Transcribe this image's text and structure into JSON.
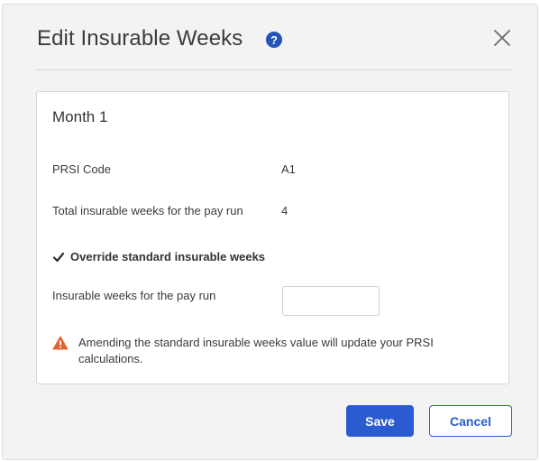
{
  "dialog": {
    "title": "Edit Insurable Weeks",
    "help_icon": "question-circle-icon",
    "close_icon": "close-x-icon"
  },
  "card": {
    "title": "Month 1",
    "prsi_code_label": "PRSI Code",
    "prsi_code_value": "A1",
    "total_weeks_label": "Total insurable weeks for the pay run",
    "total_weeks_value": "4",
    "override_checkbox_label": "Override standard insurable weeks",
    "override_checked": true,
    "weeks_input_label": "Insurable weeks for the pay run",
    "weeks_input_value": "",
    "warning_icon": "warning-triangle-icon",
    "warning_text": "Amending the standard insurable weeks value will update your PRSI calculations."
  },
  "footer": {
    "save_label": "Save",
    "cancel_label": "Cancel"
  },
  "colors": {
    "accent": "#2a5bd0",
    "help_icon": "#2554b8",
    "warning": "#e5622a",
    "dialog_bg": "#f3f3f4"
  }
}
